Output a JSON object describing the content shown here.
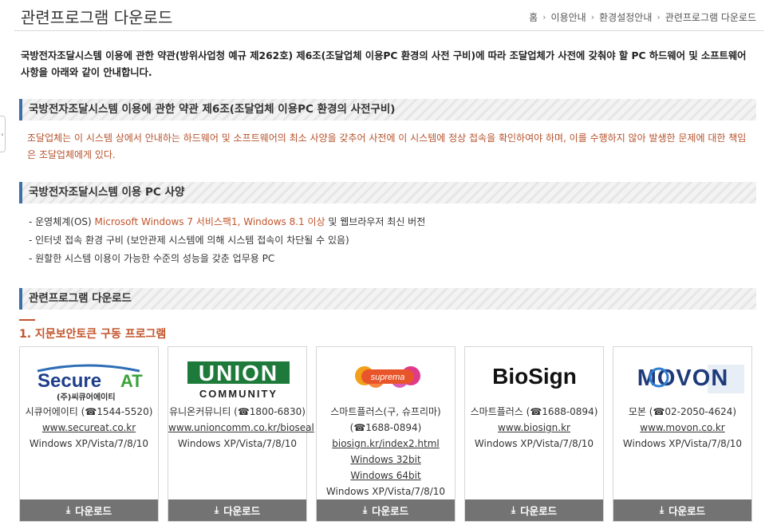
{
  "page": {
    "title": "관련프로그램 다운로드",
    "breadcrumb": [
      "홈",
      "이용안내",
      "환경설정안내",
      "관련프로그램 다운로드"
    ]
  },
  "intro": "국방전자조달시스템 이용에 관한 약관(방위사업청 예규 제262호) 제6조(조달업체 이용PC 환경의 사전 구비)에 따라 조달업체가 사전에 갖춰야 할 PC 하드웨어 및 소프트웨어 사항을 아래와 같이 안내합니다.",
  "section1": {
    "title": "국방전자조달시스템 이용에 관한 약관 제6조(조달업체 이용PC 환경의 사전구비)",
    "notice": "조달업체는 이 시스템 상에서 안내하는 하드웨어 및 소프트웨어의 최소 사양을 갖추어 사전에 이 시스템에 정상 접속을 확인하여야 하며, 이를 수행하지 않아 발생한 문제에 대한 책임은 조달업체에게 있다."
  },
  "section2": {
    "title": "국방전자조달시스템 이용 PC 사양",
    "spec1_prefix": "- 운영체계(OS) ",
    "spec1_highlight": "Microsoft Windows 7 서비스팩1, Windows 8.1 이상",
    "spec1_suffix": " 및 웹브라우저 최신 버전",
    "spec2": "- 인터넷 접속 환경 구비 (보안관제 시스템에 의해 시스템 접속이 차단될 수 있음)",
    "spec3": "- 원할한 시스템 이용이 가능한 수준의 성능을 갖춘 업무용 PC"
  },
  "section3": {
    "title": "관련프로그램 다운로드",
    "subheading": "1. 지문보안토큰 구동 프로그램"
  },
  "download_label": "다운로드",
  "cards": [
    {
      "logo": {
        "main": "Secure",
        "accent": "AT",
        "sub": "(주)씨큐어에이티"
      },
      "company": "시큐어에이티 (☎1544-5520)",
      "url": "www.secureat.co.kr",
      "os": "Windows XP/Vista/7/8/10"
    },
    {
      "logo": {
        "main": "UNION",
        "sub": "COMMUNITY"
      },
      "company": "유니온커뮤니티 (☎1800-6830)",
      "url": "www.unioncomm.co.kr/bioseal",
      "os": "Windows XP/Vista/7/8/10"
    },
    {
      "logo": {
        "main": "suprema"
      },
      "company": "스마트플러스(구, 슈프리마)",
      "phone": "(☎1688-0894)",
      "url": "biosign.kr/index2.html",
      "link32": "Windows 32bit",
      "link64": "Windows 64bit",
      "os": "Windows XP/Vista/7/8/10"
    },
    {
      "logo": {
        "main": "BioSign"
      },
      "company": "스마트플러스 (☎1688-0894)",
      "url": "www.biosign.kr",
      "os": "Windows XP/Vista/7/8/10"
    },
    {
      "logo": {
        "main": "MOVON"
      },
      "company": "모본 (☎02-2050-4624)",
      "url": "www.movon.co.kr",
      "os": "Windows XP/Vista/7/8/10"
    }
  ],
  "colors": {
    "accent": "#c2552c",
    "section_bar": "#3f6fa8",
    "button": "#737373"
  }
}
